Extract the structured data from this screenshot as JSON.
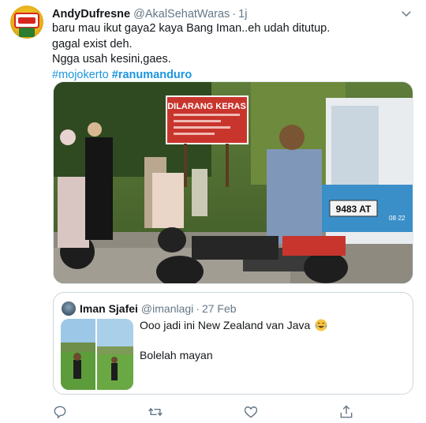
{
  "author": {
    "name": "AndyDufresne",
    "handle": "@AkalSehatWaras",
    "time": "1j",
    "avatar_icon": "avatar-dancow-logo"
  },
  "tweet": {
    "lines": [
      "baru mau ikut gaya2 kaya Bang Iman..eh udah ditutup.",
      "gagal exist deh.",
      "Ngga usah kesini,gaes."
    ],
    "hashtags": [
      "#mojokerto",
      "#ranumanduro"
    ]
  },
  "photo": {
    "sign_title": "DILARANG KERAS",
    "plate": "9483 AT",
    "plate_sub": "08·22"
  },
  "quoted_tweet": {
    "name": "Iman Sjafei",
    "handle": "@imanlagi",
    "time": "27 Feb",
    "lines": [
      "Ooo jadi ini New Zealand van Java",
      "Bolelah mayan"
    ],
    "emoji_icon": "tears-of-joy-emoji"
  },
  "actions": [
    "reply-icon",
    "retweet-icon",
    "like-icon",
    "share-icon"
  ],
  "colors": {
    "link": "#1b95e0",
    "secondary": "#657786",
    "text": "#14171a",
    "border": "#ccd6dd"
  }
}
